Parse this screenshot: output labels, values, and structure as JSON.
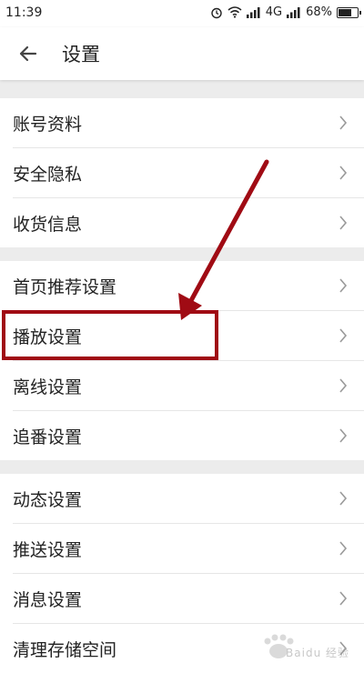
{
  "statusbar": {
    "time": "11:39",
    "network": "4G",
    "battery": "68%"
  },
  "header": {
    "title": "设置"
  },
  "groups": [
    {
      "items": [
        "账号资料",
        "安全隐私",
        "收货信息"
      ]
    },
    {
      "items": [
        "首页推荐设置",
        "播放设置",
        "离线设置",
        "追番设置"
      ]
    },
    {
      "items": [
        "动态设置",
        "推送设置",
        "消息设置",
        "清理存储空间"
      ]
    }
  ],
  "annotation": {
    "color": "#a00b14",
    "highlighted_item": "播放设置"
  },
  "watermark": {
    "text": "Baidu 经验"
  }
}
